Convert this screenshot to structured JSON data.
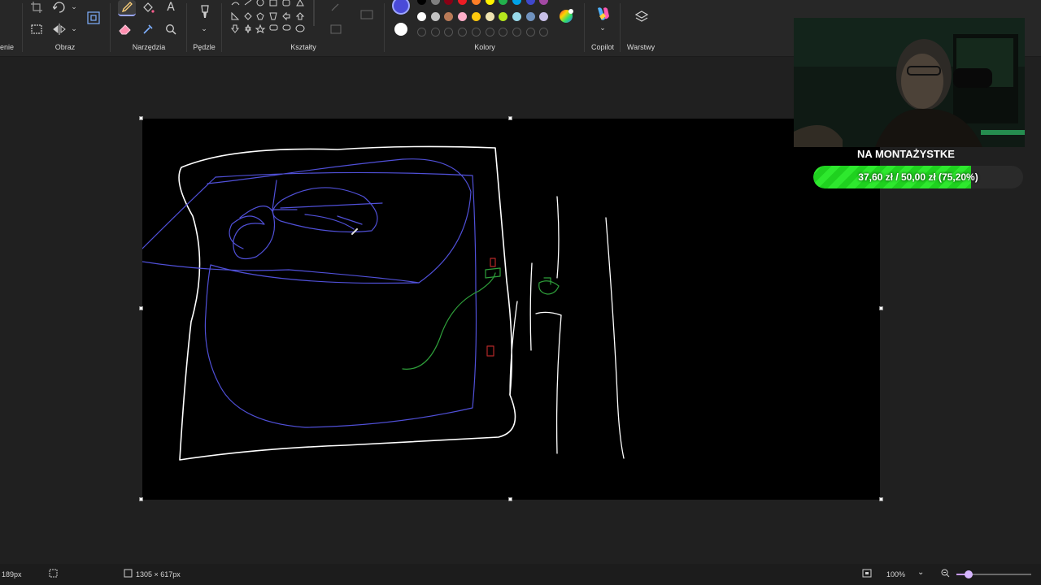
{
  "ribbon": {
    "groups": {
      "selection": "enie",
      "image": "Obraz",
      "tools": "Narzędzia",
      "brushes": "Pędzle",
      "shapes": "Kształty",
      "colors": "Kolory",
      "copilot": "Copilot",
      "layers": "Warstwy"
    },
    "icons": {
      "crop": "crop-icon",
      "rotate": "rotate-icon",
      "resize": "resize-icon",
      "select_all": "select-all-icon",
      "flip": "flip-icon",
      "pencil": "pencil-icon",
      "fill": "fill-bucket-icon",
      "text": "text-icon",
      "eraser": "eraser-icon",
      "color_picker": "color-picker-icon",
      "magnifier": "magnifier-icon",
      "brush": "brush-icon",
      "copilot": "copilot-icon",
      "layers": "layers-icon"
    },
    "current_color": "#4a4ad8",
    "secondary_color": "#ffffff",
    "palette_row1": [
      "#000000",
      "#7f7f7f",
      "#880015",
      "#ed1c24",
      "#ff7f27",
      "#fff200",
      "#22b14c",
      "#00a2e8",
      "#3f48cc",
      "#a349a4"
    ],
    "palette_row2": [
      "#ffffff",
      "#c3c3c3",
      "#b97a57",
      "#ffaec9",
      "#ffc90e",
      "#efe4b0",
      "#b5e61d",
      "#99d9ea",
      "#7092be",
      "#c8bfe7"
    ]
  },
  "overlay": {
    "title": "NA MONTAŻYSTKE",
    "goal_text": "37,60 zł / 50,00 zł (75,20%)",
    "goal_fraction": 0.752
  },
  "statusbar": {
    "cursor_pos": "189px",
    "canvas_size": "1305 × 617px",
    "zoom": "100%",
    "zoom_level": 0.5
  }
}
